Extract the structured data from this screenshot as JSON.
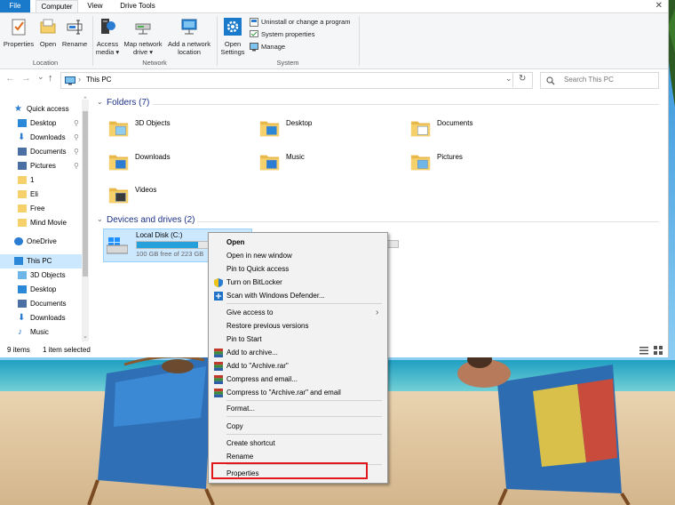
{
  "window": {
    "tabs": [
      "File",
      "Computer",
      "View",
      "Drive Tools"
    ],
    "close_glyph": "✕"
  },
  "ribbon": {
    "location": {
      "buttons": [
        "Properties",
        "Open",
        "Rename"
      ],
      "label": "Location"
    },
    "network": {
      "buttons": [
        [
          "Access",
          "media ▾"
        ],
        [
          "Map network",
          "drive ▾"
        ],
        [
          "Add a network",
          "location"
        ]
      ],
      "label": "Network"
    },
    "system": {
      "open_settings": [
        "Open",
        "Settings"
      ],
      "items": [
        "Uninstall or change a program",
        "System properties",
        "Manage"
      ],
      "label": "System"
    }
  },
  "address": {
    "back": "←",
    "forward": "→",
    "recent": "⌄",
    "up": "↑",
    "sep": "›",
    "path": "This PC",
    "dropdown": "⌄",
    "refresh": "↻",
    "search_placeholder": "Search This PC"
  },
  "nav": {
    "items": [
      {
        "label": "Quick access",
        "icon": "star-icon",
        "pinned": false,
        "color": "#2b7cd3"
      },
      {
        "label": "Desktop",
        "icon": "desktop-icon",
        "pinned": true,
        "color": "#2b88d8"
      },
      {
        "label": "Downloads",
        "icon": "downloads-icon",
        "pinned": true,
        "color": "#2b7cd3"
      },
      {
        "label": "Documents",
        "icon": "documents-icon",
        "pinned": true,
        "color": "#4c6fa3"
      },
      {
        "label": "Pictures",
        "icon": "pictures-icon",
        "pinned": true,
        "color": "#4c6fa3"
      },
      {
        "label": "1",
        "icon": "folder-icon",
        "pinned": false,
        "color": "#f6d16b"
      },
      {
        "label": "Eli",
        "icon": "folder-icon",
        "pinned": false,
        "color": "#f6d16b"
      },
      {
        "label": "Free",
        "icon": "folder-icon",
        "pinned": false,
        "color": "#f6d16b"
      },
      {
        "label": "Mind Movie",
        "icon": "folder-icon",
        "pinned": false,
        "color": "#f6d16b"
      },
      {
        "label": "OneDrive",
        "icon": "cloud-icon",
        "pinned": false,
        "color": "#2b7cd3"
      },
      {
        "label": "This PC",
        "icon": "computer-icon",
        "pinned": false,
        "color": "#2b88d8"
      },
      {
        "label": "3D Objects",
        "icon": "cube-icon",
        "pinned": false,
        "color": "#6fb6e8"
      },
      {
        "label": "Desktop",
        "icon": "desktop-icon",
        "pinned": false,
        "color": "#2b88d8"
      },
      {
        "label": "Documents",
        "icon": "documents-icon",
        "pinned": false,
        "color": "#4c6fa3"
      },
      {
        "label": "Downloads",
        "icon": "downloads-icon",
        "pinned": false,
        "color": "#2b7cd3"
      },
      {
        "label": "Music",
        "icon": "music-icon",
        "pinned": false,
        "color": "#2b7cd3"
      }
    ],
    "pin_glyph": "📌",
    "scroll_up": "⌃",
    "scroll_down": "⌄"
  },
  "content": {
    "folders_header": "Folders (7)",
    "folders": [
      {
        "label": "3D Objects",
        "icon": "3d-objects-folder-icon"
      },
      {
        "label": "Desktop",
        "icon": "desktop-folder-icon"
      },
      {
        "label": "Documents",
        "icon": "documents-folder-icon"
      },
      {
        "label": "Downloads",
        "icon": "downloads-folder-icon"
      },
      {
        "label": "Music",
        "icon": "music-folder-icon"
      },
      {
        "label": "Pictures",
        "icon": "pictures-folder-icon"
      },
      {
        "label": "Videos",
        "icon": "videos-folder-icon"
      }
    ],
    "drives_header": "Devices and drives (2)",
    "drive": {
      "name": "Local Disk (C:)",
      "free": "100 GB free of 223 GB",
      "used_fraction": 0.55
    },
    "collapse_glyph": "⌄"
  },
  "status": {
    "count": "9 items",
    "selected": "1 item selected"
  },
  "context_menu": {
    "items": [
      {
        "label": "Open",
        "bold": true,
        "icon": ""
      },
      {
        "label": "Open in new window",
        "icon": ""
      },
      {
        "label": "Pin to Quick access",
        "icon": ""
      },
      {
        "label": "Turn on BitLocker",
        "icon": "shield-icon"
      },
      {
        "label": "Scan with Windows Defender...",
        "icon": "defender-icon"
      },
      {
        "label": "Give access to",
        "icon": "",
        "submenu": true
      },
      {
        "label": "Restore previous versions",
        "icon": ""
      },
      {
        "label": "Pin to Start",
        "icon": ""
      },
      {
        "label": "Add to archive...",
        "icon": "winrar-icon"
      },
      {
        "label": "Add to \"Archive.rar\"",
        "icon": "winrar-icon"
      },
      {
        "label": "Compress and email...",
        "icon": "winrar-icon"
      },
      {
        "label": "Compress to \"Archive.rar\" and email",
        "icon": "winrar-icon"
      },
      {
        "label": "Format...",
        "icon": ""
      },
      {
        "label": "Copy",
        "icon": ""
      },
      {
        "label": "Create shortcut",
        "icon": ""
      },
      {
        "label": "Rename",
        "icon": ""
      },
      {
        "label": "Properties",
        "icon": ""
      }
    ],
    "submenu_glyph": "›"
  },
  "colors": {
    "accent": "#1979ca",
    "folder": "#f6d16b",
    "highlight": "#e0181b",
    "drive_bar": "#26a0da"
  }
}
